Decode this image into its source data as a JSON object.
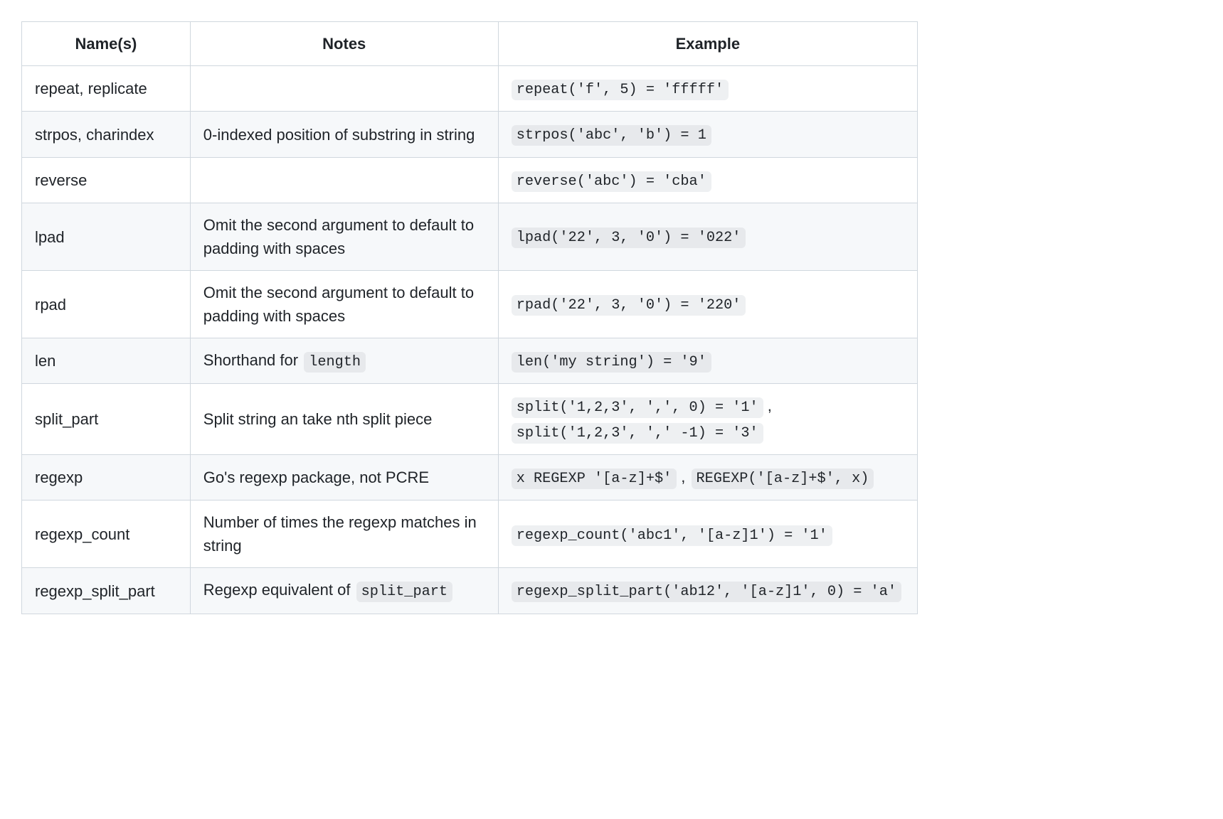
{
  "headers": {
    "name": "Name(s)",
    "notes": "Notes",
    "example": "Example"
  },
  "rows": [
    {
      "name": "repeat, replicate",
      "notes_text": "",
      "examples": [
        "repeat('f', 5) = 'fffff'"
      ]
    },
    {
      "name": "strpos, charindex",
      "notes_text": "0-indexed position of substring in string",
      "examples": [
        "strpos('abc', 'b') = 1"
      ]
    },
    {
      "name": "reverse",
      "notes_text": "",
      "examples": [
        "reverse('abc') = 'cba'"
      ]
    },
    {
      "name": "lpad",
      "notes_text": "Omit the second argument to default to padding with spaces",
      "examples": [
        "lpad('22', 3, '0') = '022'"
      ]
    },
    {
      "name": "rpad",
      "notes_text": "Omit the second argument to default to padding with spaces",
      "examples": [
        "rpad('22', 3, '0') = '220'"
      ]
    },
    {
      "name": "len",
      "notes_prefix": "Shorthand for ",
      "notes_code": "length",
      "examples": [
        "len('my string') = '9'"
      ]
    },
    {
      "name": "split_part",
      "notes_text": "Split string an take nth split piece",
      "examples": [
        "split('1,2,3', ',', 0) = '1'",
        "split('1,2,3', ',' -1) = '3'"
      ],
      "sep": ","
    },
    {
      "name": "regexp",
      "notes_text": "Go's regexp package, not PCRE",
      "examples": [
        "x REGEXP '[a-z]+$'",
        "REGEXP('[a-z]+$', x)"
      ],
      "sep": ","
    },
    {
      "name": "regexp_count",
      "notes_text": "Number of times the regexp matches in string",
      "examples": [
        "regexp_count('abc1', '[a-z]1') = '1'"
      ]
    },
    {
      "name": "regexp_split_part",
      "notes_prefix": "Regexp equivalent of ",
      "notes_code": "split_part",
      "examples": [
        "regexp_split_part('ab12', '[a-z]1', 0) = 'a'"
      ]
    }
  ]
}
